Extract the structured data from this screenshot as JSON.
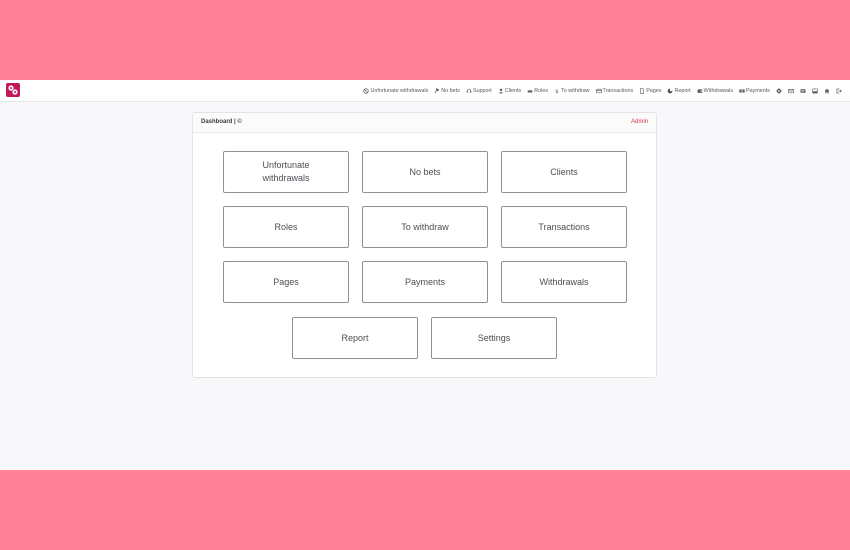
{
  "navbar": {
    "items": [
      {
        "label": "Unfortunate withdrawals",
        "icon": "ban-icon"
      },
      {
        "label": "No bets",
        "icon": "hammer-icon"
      },
      {
        "label": "Support",
        "icon": "headset-icon"
      },
      {
        "label": "Clients",
        "icon": "user-icon"
      },
      {
        "label": "Roles",
        "icon": "crown-icon"
      },
      {
        "label": "To withdraw",
        "icon": "dollar-icon"
      },
      {
        "label": "Transactions",
        "icon": "card-icon"
      },
      {
        "label": "Pages",
        "icon": "page-icon"
      },
      {
        "label": "Report",
        "icon": "chart-icon"
      },
      {
        "label": "Withdrawals",
        "icon": "wallet-icon"
      },
      {
        "label": "Payments",
        "icon": "money-icon"
      }
    ],
    "icons": [
      "settings-icon",
      "mail-icon",
      "message-icon",
      "inbox-icon",
      "home-icon",
      "logout-icon"
    ]
  },
  "card": {
    "title": "Dashboard | ©",
    "user": "Admin"
  },
  "tiles": [
    "Unfortunate withdrawals",
    "No bets",
    "Clients",
    "Roles",
    "To withdraw",
    "Transactions",
    "Pages",
    "Payments",
    "Withdrawals",
    "Report",
    "Settings"
  ],
  "colors": {
    "frame": "#ff8299",
    "brand": "#c2185b",
    "accent": "#d33a4a"
  }
}
